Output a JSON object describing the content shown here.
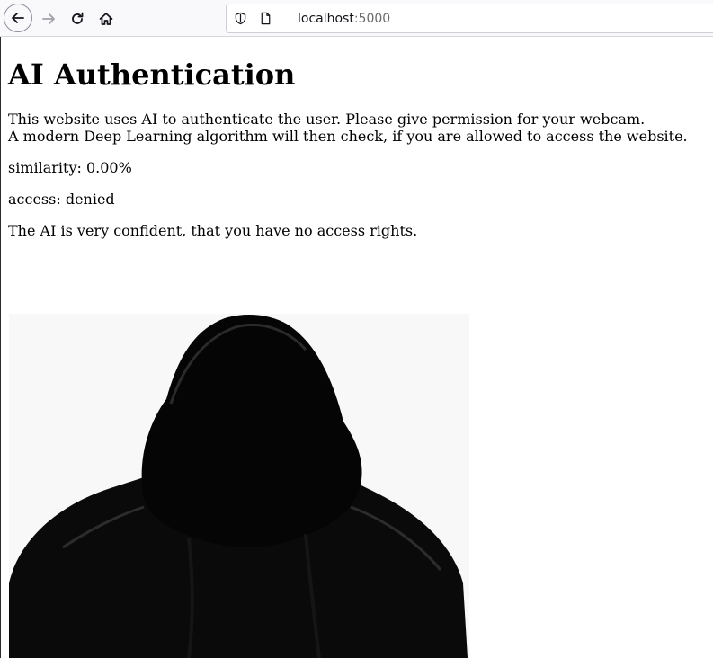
{
  "browser": {
    "url_host": "localhost",
    "url_port": ":5000",
    "icons": {
      "back": "arrow-left-icon",
      "forward": "arrow-right-icon",
      "reload": "reload-icon",
      "home": "home-icon",
      "tracking": "shield-icon",
      "page": "page-icon"
    }
  },
  "page": {
    "title": "AI Authentication",
    "intro_line1": "This website uses AI to authenticate the user. Please give permission for your webcam.",
    "intro_line2": "A modern Deep Learning algorithm will then check, if you are allowed to access the website.",
    "similarity": "similarity: 0.00%",
    "access": "access: denied",
    "verdict": "The AI is very confident, that you have no access rights.",
    "image_subject": "hooded-figure-photo"
  },
  "colors": {
    "toolbar_bg": "#f9f9fb",
    "page_bg": "#ffffff",
    "text": "#000000"
  }
}
